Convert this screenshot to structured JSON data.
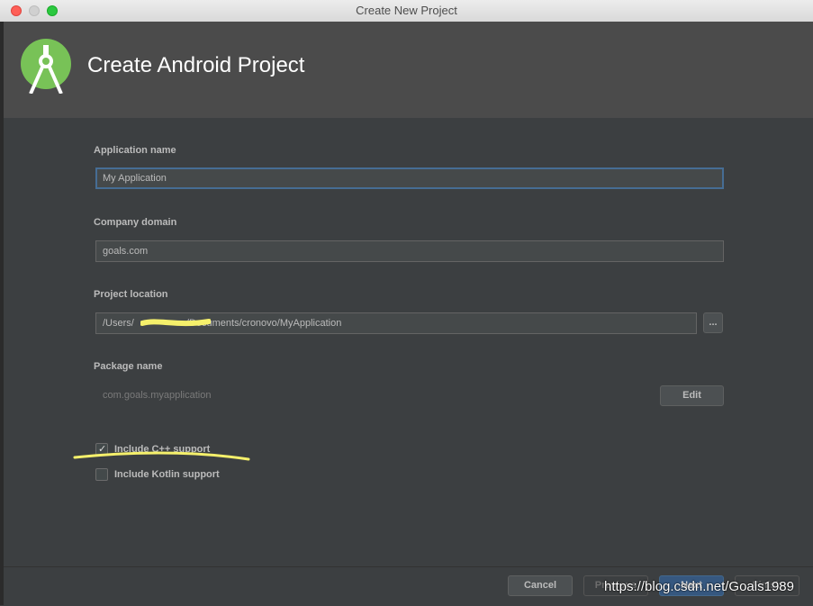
{
  "window": {
    "title": "Create New Project"
  },
  "header": {
    "title": "Create Android Project",
    "logo_icon": "android-studio-logo-icon"
  },
  "form": {
    "app_name_label": "Application name",
    "app_name_value": "My Application",
    "company_domain_label": "Company domain",
    "company_domain_value": "goals.com",
    "project_location_label": "Project location",
    "project_location_value": "/Users/                   /Documents/cronovo/MyApplication",
    "browse_label": "...",
    "package_name_label": "Package name",
    "package_name_value": "com.goals.myapplication",
    "edit_label": "Edit",
    "cpp_support_label": "Include C++ support",
    "cpp_support_checked": true,
    "kotlin_support_label": "Include Kotlin support",
    "kotlin_support_checked": false
  },
  "footer": {
    "cancel_label": "Cancel",
    "previous_label": "Previous",
    "next_label": "Next",
    "finish_label": "Finish"
  },
  "watermark": "https://blog.csdn.net/Goals1989",
  "colors": {
    "background": "#3c3f41",
    "header": "#4b4b4b",
    "focus_border": "#466d94",
    "default_button": "#365880",
    "annotation_highlight": "#f5f06b"
  }
}
